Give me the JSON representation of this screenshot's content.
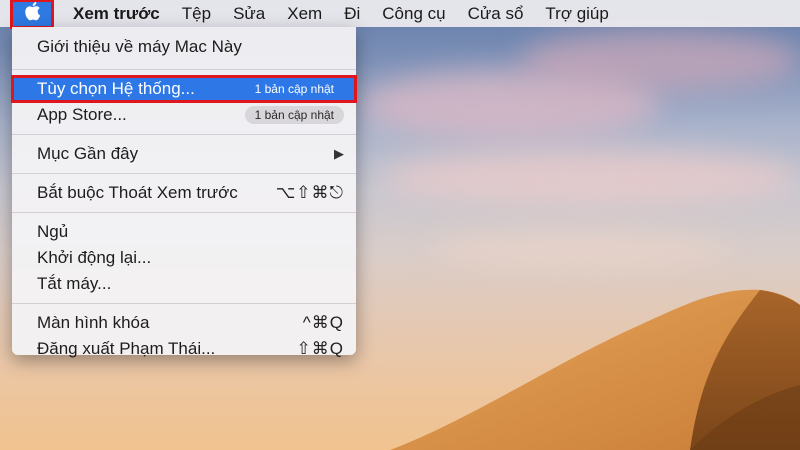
{
  "menubar": {
    "apple_icon": "apple-logo-icon",
    "app_name": "Xem trước",
    "menus": [
      "Tệp",
      "Sửa",
      "Xem",
      "Đi",
      "Công cụ",
      "Cửa sổ",
      "Trợ giúp"
    ]
  },
  "apple_menu": {
    "about": "Giới thiệu về máy Mac Này",
    "system_prefs": {
      "label": "Tùy chọn Hệ thống...",
      "badge": "1 bản cập nhật"
    },
    "app_store": {
      "label": "App Store...",
      "badge": "1 bản cập nhật"
    },
    "recent_items": {
      "label": "Mục Gần đây",
      "arrow": "▶"
    },
    "force_quit": {
      "label": "Bắt buộc Thoát Xem trước",
      "shortcut": "⌥⇧⌘⎋"
    },
    "sleep": "Ngủ",
    "restart": "Khởi động lại...",
    "shutdown": "Tắt máy...",
    "lock_screen": {
      "label": "Màn hình khóa",
      "shortcut": "^⌘Q"
    },
    "logout": {
      "label": "Đăng xuất Phạm Thái...",
      "shortcut": "⇧⌘Q"
    }
  },
  "colors": {
    "highlight": "#2d77e6",
    "annotation_red": "#e0161e"
  }
}
